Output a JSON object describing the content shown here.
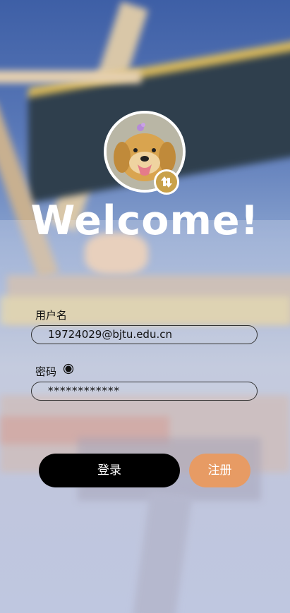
{
  "header": {
    "title": "Welcome!"
  },
  "avatar": {
    "icon": "dog-photo-avatar",
    "badge_icon": "swap-arrows-icon",
    "badge_color": "#c9a14a"
  },
  "form": {
    "username_label": "用户名",
    "username_value": "19724029@bjtu.edu.cn",
    "password_label": "密码",
    "password_value": "************",
    "password_toggle_icon": "eye-toggle-icon"
  },
  "actions": {
    "login_label": "登录",
    "register_label": "注册",
    "login_color": "#000000",
    "register_color": "#e79b64"
  }
}
